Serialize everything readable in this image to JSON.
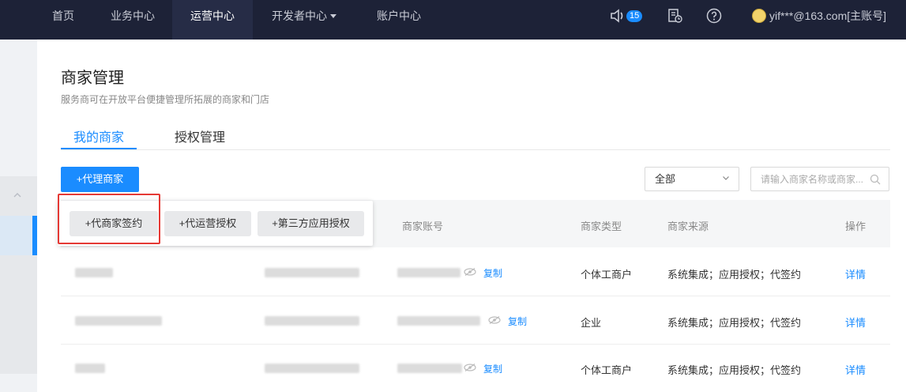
{
  "nav": {
    "items": [
      "首页",
      "业务中心",
      "运营中心",
      "开发者中心",
      "账户中心"
    ],
    "active_index": 2,
    "notification_count": "15",
    "user": "yif***@163.com[主账号]"
  },
  "page": {
    "title": "商家管理",
    "subtitle": "服务商可在开放平台便捷管理所拓展的商家和门店"
  },
  "tabs": [
    "我的商家",
    "授权管理"
  ],
  "toolbar": {
    "agent_button": "+代理商家",
    "filter_value": "全部",
    "search_placeholder": "请输入商家名称或商家..."
  },
  "dropdown": {
    "items": [
      "+代商家签约",
      "+代运营授权",
      "+第三方应用授权"
    ]
  },
  "table": {
    "headers": {
      "account": "商家账号",
      "type": "商家类型",
      "source": "商家来源",
      "action": "操作"
    },
    "rows": [
      {
        "copy": "复制",
        "type": "个体工商户",
        "source": "系统集成；应用授权；代签约",
        "action": "详情"
      },
      {
        "copy": "复制",
        "type": "企业",
        "source": "系统集成；应用授权；代签约",
        "action": "详情"
      },
      {
        "copy": "复制",
        "type": "个体工商户",
        "source": "系统集成；应用授权；代签约",
        "action": "详情"
      }
    ]
  },
  "colors": {
    "accent": "#1a8cff",
    "topbar": "#1d2237",
    "highlight_frame": "#e53935"
  }
}
